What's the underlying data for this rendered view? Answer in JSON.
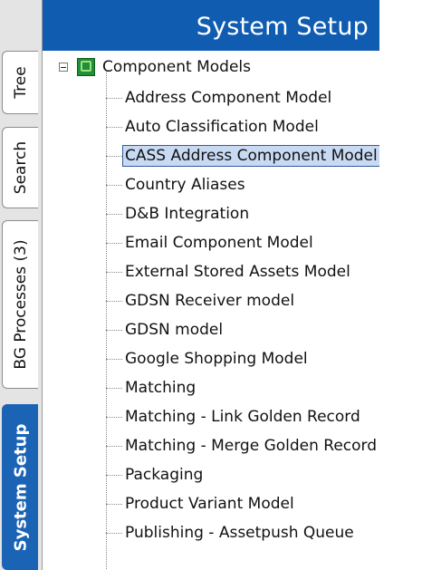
{
  "header": {
    "title": "System Setup"
  },
  "tabs": [
    {
      "label": "Tree",
      "active": false
    },
    {
      "label": "Search",
      "active": false
    },
    {
      "label": "BG Processes (3)",
      "active": false
    },
    {
      "label": "System Setup",
      "active": true
    }
  ],
  "tree": {
    "root": {
      "label": "Component Models",
      "icon": "component-models-icon",
      "expanded": true
    },
    "items": [
      {
        "label": "Address Component Model"
      },
      {
        "label": "Auto Classification Model"
      },
      {
        "label": "CASS Address Component Model",
        "selected": true
      },
      {
        "label": "Country Aliases"
      },
      {
        "label": "D&B Integration"
      },
      {
        "label": "Email Component Model"
      },
      {
        "label": "External Stored Assets Model"
      },
      {
        "label": "GDSN Receiver model"
      },
      {
        "label": "GDSN model"
      },
      {
        "label": "Google Shopping Model"
      },
      {
        "label": "Matching"
      },
      {
        "label": "Matching - Link Golden Record"
      },
      {
        "label": "Matching - Merge Golden Record"
      },
      {
        "label": "Packaging"
      },
      {
        "label": "Product Variant Model"
      },
      {
        "label": "Publishing - Assetpush Queue"
      }
    ]
  },
  "colors": {
    "header": "#0f5cb0",
    "active_tab": "#1b64b5",
    "selection": "#c8daf3"
  }
}
